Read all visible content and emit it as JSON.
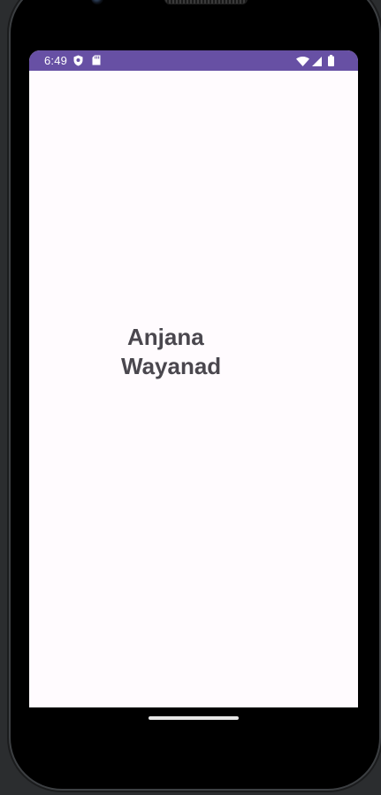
{
  "status_bar": {
    "time": "6:49",
    "left_icons": [
      "shield-icon",
      "sd-card-icon"
    ],
    "right_icons": [
      "wifi-icon",
      "signal-icon",
      "battery-icon"
    ],
    "color": "#6750a4"
  },
  "main": {
    "name": "Anjana",
    "place": "Wayanad",
    "background": "#fffbfe",
    "text_color": "#4a474e"
  }
}
